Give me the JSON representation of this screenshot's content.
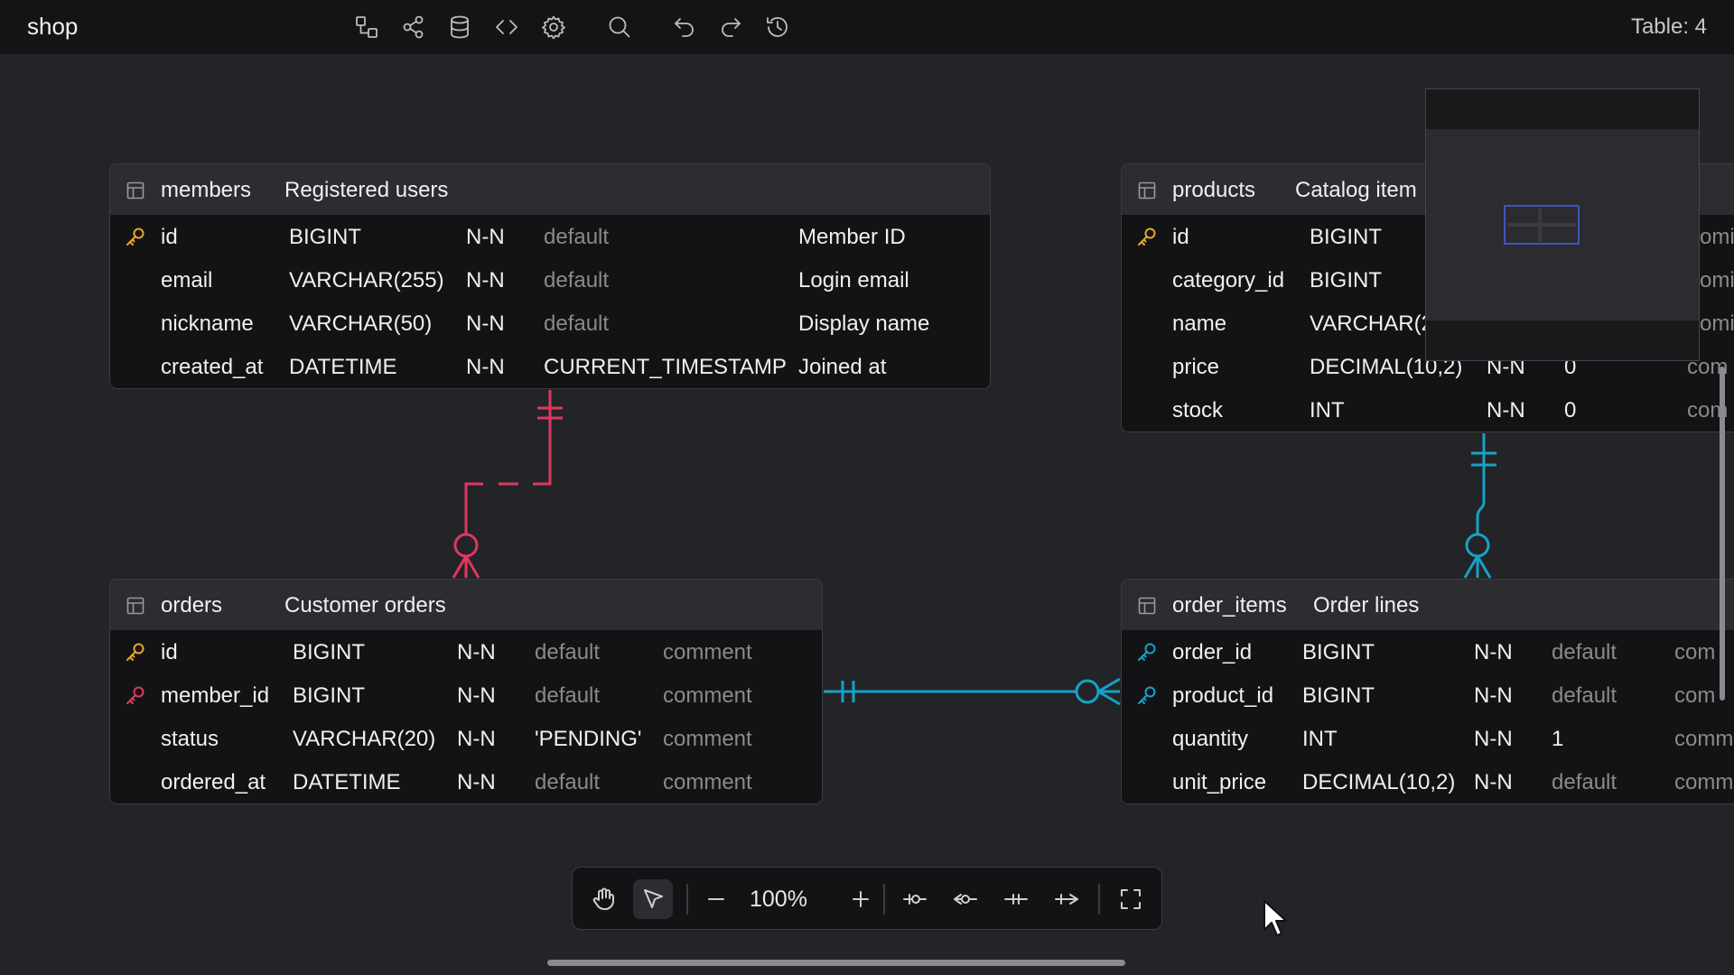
{
  "app": {
    "title": "shop",
    "table_count": "Table: 4"
  },
  "toolbar": {
    "icons": [
      "diagram-icon",
      "share-icon",
      "database-icon",
      "code-icon",
      "settings-icon",
      "search-icon",
      "undo-icon",
      "redo-icon",
      "history-icon"
    ]
  },
  "tables": {
    "members": {
      "name": "members",
      "comment": "Registered users",
      "columns": [
        {
          "name": "id",
          "type": "BIGINT",
          "null": "N-N",
          "default": "default",
          "comment": "Member ID",
          "key": "primary"
        },
        {
          "name": "email",
          "type": "VARCHAR(255)",
          "null": "N-N",
          "default": "default",
          "comment": "Login email",
          "key": ""
        },
        {
          "name": "nickname",
          "type": "VARCHAR(50)",
          "null": "N-N",
          "default": "default",
          "comment": "Display name",
          "key": ""
        },
        {
          "name": "created_at",
          "type": "DATETIME",
          "null": "N-N",
          "default": "CURRENT_TIMESTAMP",
          "comment": "Joined at",
          "key": ""
        }
      ]
    },
    "products": {
      "name": "products",
      "comment": "Catalog item",
      "columns": [
        {
          "name": "id",
          "type": "BIGINT",
          "null": "",
          "default": "",
          "comment": "omi",
          "key": "primary"
        },
        {
          "name": "category_id",
          "type": "BIGINT",
          "null": "",
          "default": "",
          "comment": "omi",
          "key": ""
        },
        {
          "name": "name",
          "type": "VARCHAR(2",
          "null": "",
          "default": "",
          "comment": "omi",
          "key": ""
        },
        {
          "name": "price",
          "type": "DECIMAL(10,2)",
          "null": "N-N",
          "default": "0",
          "comment": "com",
          "key": ""
        },
        {
          "name": "stock",
          "type": "INT",
          "null": "N-N",
          "default": "0",
          "comment": "com",
          "key": ""
        }
      ]
    },
    "orders": {
      "name": "orders",
      "comment": "Customer orders",
      "columns": [
        {
          "name": "id",
          "type": "BIGINT",
          "null": "N-N",
          "default": "default",
          "comment": "comment",
          "key": "primary"
        },
        {
          "name": "member_id",
          "type": "BIGINT",
          "null": "N-N",
          "default": "default",
          "comment": "comment",
          "key": "foreign"
        },
        {
          "name": "status",
          "type": "VARCHAR(20)",
          "null": "N-N",
          "default": "'PENDING'",
          "comment": "comment",
          "key": ""
        },
        {
          "name": "ordered_at",
          "type": "DATETIME",
          "null": "N-N",
          "default": "default",
          "comment": "comment",
          "key": ""
        }
      ]
    },
    "order_items": {
      "name": "order_items",
      "comment": "Order lines",
      "columns": [
        {
          "name": "order_id",
          "type": "BIGINT",
          "null": "N-N",
          "default": "default",
          "comment": "com",
          "key": "foreign"
        },
        {
          "name": "product_id",
          "type": "BIGINT",
          "null": "N-N",
          "default": "default",
          "comment": "com",
          "key": "foreign"
        },
        {
          "name": "quantity",
          "type": "INT",
          "null": "N-N",
          "default": "1",
          "comment": "comm",
          "key": ""
        },
        {
          "name": "unit_price",
          "type": "DECIMAL(10,2)",
          "null": "N-N",
          "default": "default",
          "comment": "comm",
          "key": ""
        }
      ]
    }
  },
  "colors": {
    "background": "#232428",
    "primary_key": "#e5a82a",
    "relation_red": "#e0375f",
    "relation_blue": "#17a2c8"
  },
  "bottom_toolbar": {
    "zoom": "100%",
    "icons": [
      "hand-icon",
      "pointer-icon",
      "zoom-out-icon",
      "zoom-in-icon",
      "one-to-zero-or-one-icon",
      "many-to-zero-or-one-icon",
      "one-to-one-icon",
      "one-to-many-icon",
      "fullscreen-icon"
    ]
  }
}
